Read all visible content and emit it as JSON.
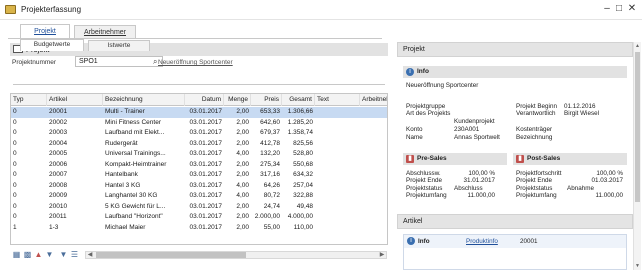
{
  "window": {
    "title": "Projekterfassung",
    "minimize_icon": "minimize-icon",
    "maximize_icon": "maximize-icon",
    "close_icon": "close-icon"
  },
  "outer_tabs": [
    {
      "label": "Projekt",
      "active": true
    },
    {
      "label": "Arbeitnehmer",
      "active": false
    }
  ],
  "project": {
    "section_title": "Projekt",
    "number_label": "Projektnummer",
    "number_value": "SPO1",
    "link_label": "Neueröffnung Sportcenter"
  },
  "inner_tabs": [
    {
      "label": "Budgetwerte",
      "active": true
    },
    {
      "label": "Istwerte",
      "active": false
    }
  ],
  "grid": {
    "headers": [
      "Typ",
      "Artikel",
      "Bezeichnung",
      "Datum",
      "Menge",
      "Preis",
      "Gesamt",
      "Text",
      "Arbeitnehm"
    ],
    "rows": [
      [
        "0",
        "20001",
        "Multi - Trainer",
        "03.01.2017",
        "2,00",
        "653,33",
        "1.306,66",
        "",
        ""
      ],
      [
        "0",
        "20002",
        "Mini Fitness Center",
        "03.01.2017",
        "2,00",
        "642,60",
        "1.285,20",
        "",
        ""
      ],
      [
        "0",
        "20003",
        "Laufband mit Elekt...",
        "03.01.2017",
        "2,00",
        "679,37",
        "1.358,74",
        "",
        ""
      ],
      [
        "0",
        "20004",
        "Rudergerät",
        "03.01.2017",
        "2,00",
        "412,78",
        "825,56",
        "",
        ""
      ],
      [
        "0",
        "20005",
        "Universal Trainings...",
        "03.01.2017",
        "4,00",
        "132,20",
        "528,80",
        "",
        ""
      ],
      [
        "0",
        "20006",
        "Kompakt-Heimtrainer",
        "03.01.2017",
        "2,00",
        "275,34",
        "550,68",
        "",
        ""
      ],
      [
        "0",
        "20007",
        "Hantelbank",
        "03.01.2017",
        "2,00",
        "317,16",
        "634,32",
        "",
        ""
      ],
      [
        "0",
        "20008",
        "Hantel 3 KG",
        "03.01.2017",
        "4,00",
        "64,26",
        "257,04",
        "",
        ""
      ],
      [
        "0",
        "20009",
        "Langhantel 30 KG",
        "03.01.2017",
        "4,00",
        "80,72",
        "322,88",
        "",
        ""
      ],
      [
        "0",
        "20010",
        "5 KG Gewicht für L...",
        "03.01.2017",
        "2,00",
        "24,74",
        "49,48",
        "",
        ""
      ],
      [
        "0",
        "20011",
        "Laufband \"Horizont\"",
        "03.01.2017",
        "2,00",
        "2.000,00",
        "4.000,00",
        "",
        ""
      ],
      [
        "1",
        "1-3",
        "Michael Maier",
        "03.01.2017",
        "2,00",
        "55,00",
        "110,00",
        "",
        ""
      ]
    ],
    "selected_row": 0
  },
  "right_panel": {
    "header": "Projekt",
    "info": {
      "title": "Info",
      "description": "Neueröffnung Sportcenter",
      "left": [
        {
          "label": "Projektgruppe",
          "value": ""
        },
        {
          "label": "Art des Projekts",
          "value": "Kundenprojekt"
        },
        {
          "label": "Konto",
          "value": "230A001"
        },
        {
          "label": "Name",
          "value": "Annas Sportwelt"
        }
      ],
      "right": [
        {
          "label": "Projekt Beginn",
          "value": "01.12.2016"
        },
        {
          "label": "Verantwortlich",
          "value": "Birgit Wiesel"
        },
        {
          "label": "Kostenträger",
          "value": ""
        },
        {
          "label": "Bezeichnung",
          "value": ""
        }
      ]
    },
    "presales": {
      "title": "Pre-Sales",
      "rows": [
        {
          "label": "Abschlussw.",
          "value": "100,00 %"
        },
        {
          "label": "Projekt Ende",
          "value": "31.01.2017"
        },
        {
          "label": "Projektstatus",
          "value": "Abschluss"
        },
        {
          "label": "Projektumfang",
          "value": "11.000,00"
        }
      ]
    },
    "postsales": {
      "title": "Post-Sales",
      "rows": [
        {
          "label": "Projektfortschritt",
          "value": "100,00 %"
        },
        {
          "label": "Projekt Ende",
          "value": "01.03.2017"
        },
        {
          "label": "Projektstatus",
          "value": "Abnahme"
        },
        {
          "label": "Projektumfang",
          "value": "11.000,00"
        }
      ]
    },
    "artikel": {
      "header": "Artikel",
      "info_label": "Info",
      "link": "Produktinfo",
      "number": "20001"
    }
  },
  "colors": {
    "selected_row": "#c7daf2",
    "link": "#1f4f9a",
    "info_icon": "#3a6fb0",
    "presales_icon": "#c0504d",
    "postsales_icon": "#c0504d"
  }
}
